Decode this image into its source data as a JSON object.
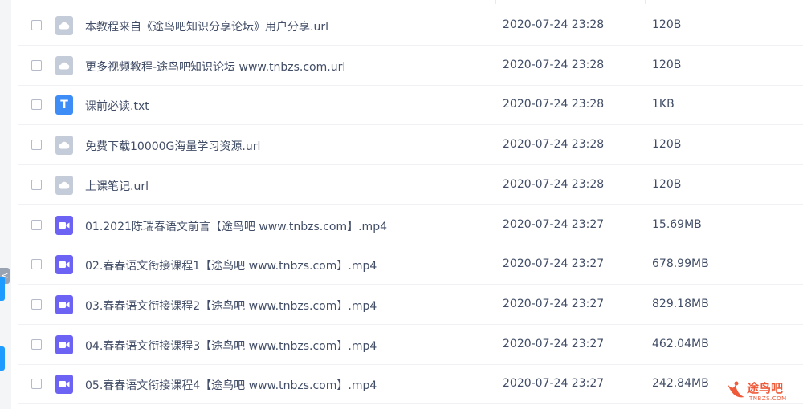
{
  "sidebar": {
    "collapse_glyph": "<"
  },
  "files": [
    {
      "icon": "cloud-link-icon",
      "type": "url",
      "name": "本教程来自《途鸟吧知识分享论坛》用户分享.url",
      "date": "2020-07-24 23:28",
      "size": "120B"
    },
    {
      "icon": "cloud-link-icon",
      "type": "url",
      "name": "更多视频教程-途鸟吧知识论坛 www.tnbzs.com.url",
      "date": "2020-07-24 23:28",
      "size": "120B"
    },
    {
      "icon": "text-file-icon",
      "type": "txt",
      "icon_letter": "T",
      "name": "课前必读.txt",
      "date": "2020-07-24 23:28",
      "size": "1KB"
    },
    {
      "icon": "cloud-link-icon",
      "type": "url",
      "name": "免费下载10000G海量学习资源.url",
      "date": "2020-07-24 23:28",
      "size": "120B"
    },
    {
      "icon": "cloud-link-icon",
      "type": "url",
      "name": "上课笔记.url",
      "date": "2020-07-24 23:28",
      "size": "120B"
    },
    {
      "icon": "video-file-icon",
      "type": "mp4",
      "name": "01.2021陈瑞春语文前言【途鸟吧 www.tnbzs.com】.mp4",
      "date": "2020-07-24 23:27",
      "size": "15.69MB"
    },
    {
      "icon": "video-file-icon",
      "type": "mp4",
      "name": "02.春春语文衔接课程1【途鸟吧 www.tnbzs.com】.mp4",
      "date": "2020-07-24 23:27",
      "size": "678.99MB"
    },
    {
      "icon": "video-file-icon",
      "type": "mp4",
      "name": "03.春春语文衔接课程2【途鸟吧 www.tnbzs.com】.mp4",
      "date": "2020-07-24 23:27",
      "size": "829.18MB"
    },
    {
      "icon": "video-file-icon",
      "type": "mp4",
      "name": "04.春春语文衔接课程3【途鸟吧 www.tnbzs.com】.mp4",
      "date": "2020-07-24 23:27",
      "size": "462.04MB"
    },
    {
      "icon": "video-file-icon",
      "type": "mp4",
      "name": "05.春春语文衔接课程4【途鸟吧 www.tnbzs.com】.mp4",
      "date": "2020-07-24 23:27",
      "size": "242.84MB"
    }
  ],
  "watermark": {
    "title": "途鸟吧",
    "subtitle": "TNBZS.COM"
  },
  "colors": {
    "url_icon": "#c5ccd9",
    "txt_icon": "#3e8cf6",
    "mp4_icon": "#6c63f5",
    "text": "#424e67",
    "watermark": "#ef5b3a"
  }
}
